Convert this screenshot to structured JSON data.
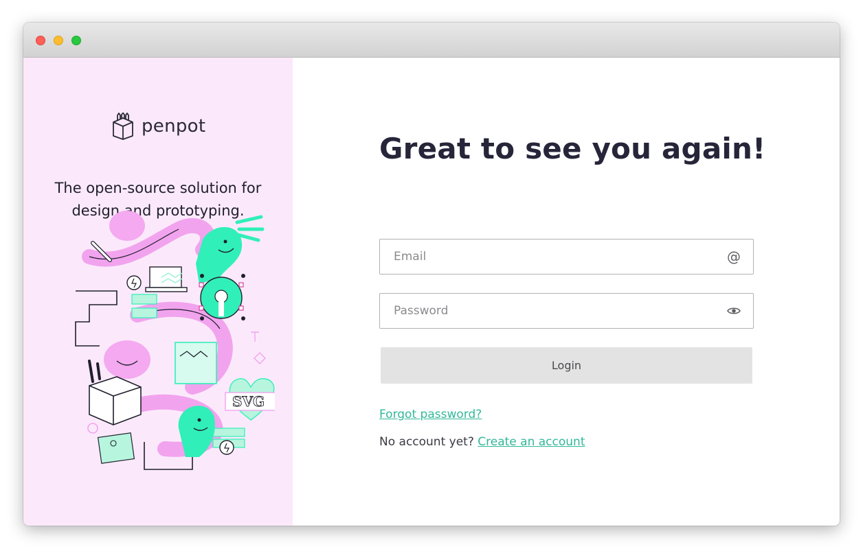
{
  "app": {
    "brand_name": "penpot",
    "tagline": "The open-source solution for design and prototyping."
  },
  "login": {
    "headline": "Great to see you again!",
    "email_placeholder": "Email",
    "email_value": "",
    "password_placeholder": "Password",
    "password_value": "",
    "login_label": "Login",
    "forgot_password_label": "Forgot password?",
    "no_account_text": "No account yet?",
    "create_account_label": "Create an account"
  },
  "icons": {
    "email_field_icon": "at-icon",
    "password_field_icon": "eye-icon",
    "logo_icon": "penpot-logo-icon"
  },
  "colors": {
    "left_panel_bg": "#fbe9fb",
    "link_green": "#31b89a",
    "headline_text": "#262539",
    "login_button_bg": "#e3e3e3",
    "illustration_pink": "#f4a9f0",
    "illustration_green": "#31efb8"
  }
}
